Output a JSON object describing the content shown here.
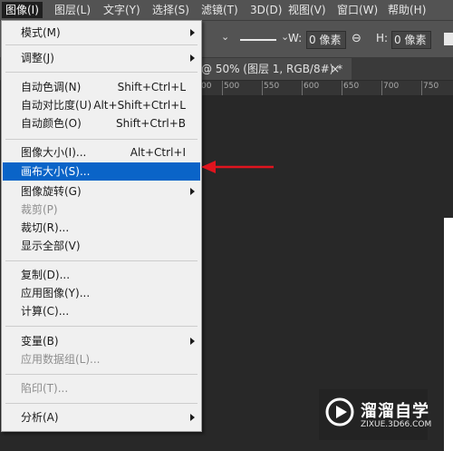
{
  "menubar": {
    "items": [
      "图像(I)",
      "图层(L)",
      "文字(Y)",
      "选择(S)",
      "滤镜(T)",
      "3D(D)",
      "视图(V)",
      "窗口(W)",
      "帮助(H)"
    ]
  },
  "options": {
    "w_label": "W:",
    "w_value": "0 像素",
    "h_label": "H:",
    "h_value": "0 像素"
  },
  "doc_tab": {
    "title": "@ 50% (图层 1, RGB/8#) *",
    "close": "×"
  },
  "ruler": {
    "labels": [
      "00",
      "500",
      "550",
      "600",
      "650",
      "700",
      "750"
    ]
  },
  "image_menu": {
    "items": [
      {
        "label": "模式(M)",
        "submenu": true
      },
      {
        "label": "调整(J)",
        "submenu": true
      },
      {
        "label": "自动色调(N)",
        "shortcut": "Shift+Ctrl+L"
      },
      {
        "label": "自动对比度(U)",
        "shortcut": "Alt+Shift+Ctrl+L"
      },
      {
        "label": "自动颜色(O)",
        "shortcut": "Shift+Ctrl+B"
      },
      {
        "label": "图像大小(I)...",
        "shortcut": "Alt+Ctrl+I"
      },
      {
        "label": "画布大小(S)...",
        "highlighted": true
      },
      {
        "label": "图像旋转(G)",
        "submenu": true
      },
      {
        "label": "裁剪(P)",
        "disabled": true
      },
      {
        "label": "裁切(R)..."
      },
      {
        "label": "显示全部(V)"
      },
      {
        "label": "复制(D)..."
      },
      {
        "label": "应用图像(Y)..."
      },
      {
        "label": "计算(C)..."
      },
      {
        "label": "变量(B)",
        "submenu": true
      },
      {
        "label": "应用数据组(L)...",
        "disabled": true
      },
      {
        "label": "陷印(T)...",
        "disabled": true
      },
      {
        "label": "分析(A)",
        "submenu": true
      }
    ]
  },
  "watermark": {
    "title": "溜溜自学",
    "url": "ZIXUE.3D66.COM"
  },
  "colors": {
    "highlight": "#0a64c8",
    "arrow": "#e0141e",
    "menubar_bg": "#535353",
    "canvas_bg": "#282828"
  }
}
